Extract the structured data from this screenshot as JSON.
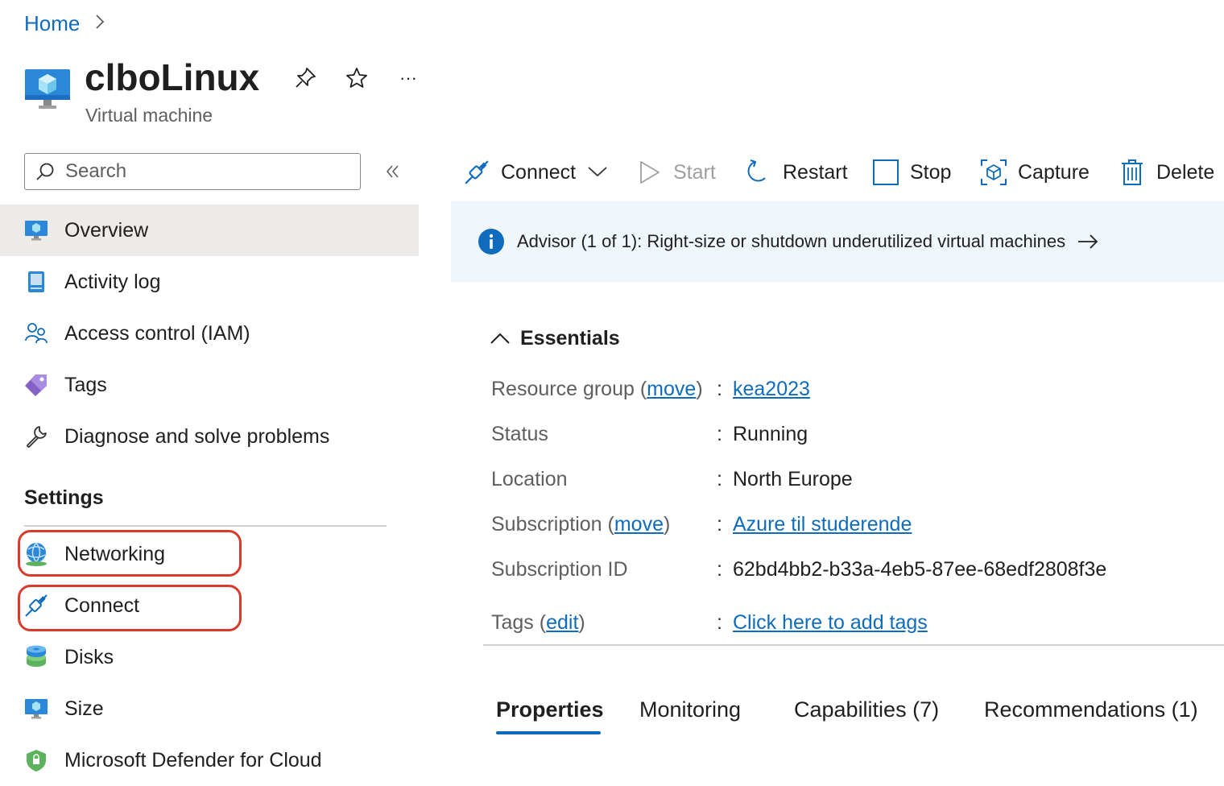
{
  "breadcrumb": {
    "home": "Home",
    "separator": ">"
  },
  "header": {
    "title": "clboLinux",
    "subtitle": "Virtual machine",
    "more_label": "···"
  },
  "sidebar": {
    "search_placeholder": "Search",
    "collapse_label": "«",
    "items": [
      {
        "label": "Overview",
        "icon": "vm-monitor-icon",
        "selected": true
      },
      {
        "label": "Activity log",
        "icon": "activity-log-icon"
      },
      {
        "label": "Access control (IAM)",
        "icon": "people-icon"
      },
      {
        "label": "Tags",
        "icon": "tag-icon"
      },
      {
        "label": "Diagnose and solve problems",
        "icon": "wrench-icon"
      }
    ],
    "settings_heading": "Settings",
    "settings_items": [
      {
        "label": "Networking",
        "icon": "network-globe-icon",
        "highlighted": true
      },
      {
        "label": "Connect",
        "icon": "plug-icon",
        "highlighted": true
      },
      {
        "label": "Disks",
        "icon": "disk-icon"
      },
      {
        "label": "Size",
        "icon": "vm-monitor-icon"
      },
      {
        "label": "Microsoft Defender for Cloud",
        "icon": "shield-icon"
      }
    ]
  },
  "toolbar": {
    "connect": "Connect",
    "start": "Start",
    "restart": "Restart",
    "stop": "Stop",
    "capture": "Capture",
    "delete": "Delete"
  },
  "advisor": {
    "text": "Advisor (1 of 1): Right-size or shutdown underutilized virtual machines"
  },
  "essentials": {
    "title": "Essentials",
    "resource_group": {
      "label": "Resource group",
      "action": "move",
      "value": "kea2023"
    },
    "status": {
      "label": "Status",
      "value": "Running"
    },
    "location": {
      "label": "Location",
      "value": "North Europe"
    },
    "subscription": {
      "label": "Subscription",
      "action": "move",
      "value": "Azure til studerende"
    },
    "subscription_id": {
      "label": "Subscription ID",
      "value": "62bd4bb2-b33a-4eb5-87ee-68edf2808f3e"
    },
    "tags": {
      "label": "Tags",
      "action": "edit",
      "value": "Click here to add tags"
    }
  },
  "tabs": [
    {
      "label": "Properties",
      "active": true
    },
    {
      "label": "Monitoring"
    },
    {
      "label": "Capabilities (7)"
    },
    {
      "label": "Recommendations (1)"
    }
  ],
  "colors": {
    "accent": "#0f6cbd",
    "highlight": "#d83b2b",
    "banner": "#eff6fc",
    "selected": "#edebe9"
  }
}
